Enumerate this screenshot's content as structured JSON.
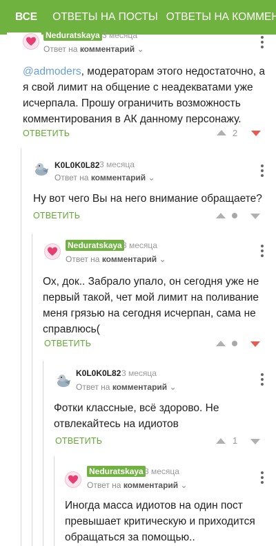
{
  "tabs": [
    "ВСЕ",
    "ОТВЕТЫ НА ПОСТЫ",
    "ОТВЕТЫ НА КОММЕНТАРИИ"
  ],
  "common": {
    "reply_to_prefix": "Ответ на",
    "reply_to_target": "комментарий",
    "reply_button": "ОТВЕТИТЬ"
  },
  "comments": [
    {
      "author": "Neduratskaya",
      "time": "3 месяца",
      "mention": "@admoders",
      "text": ", модераторам этого недостаточно, а я свой лимит на общение с неадекватами уже исчерпала. Прошу ограничить возможность комментирования в АК данному персонажу.",
      "score": "2",
      "my_vote": "down"
    },
    {
      "author": "K0L0K0L82",
      "time": "3 месяца",
      "text": "Ну вот чего Вы на него внимание обращаете?",
      "score": "",
      "my_vote": "none"
    },
    {
      "author": "Neduratskaya",
      "time": "3 месяца",
      "text": "Ох, док.. Забрало упало, он сегодня уже не первый такой, чет мой лимит на поливание меня грязью на сегодня исчерпан, сама не справлюсь(",
      "score": "",
      "my_vote": "down"
    },
    {
      "author": "K0L0K0L82",
      "time": "3 месяца",
      "text": "Фотки классные, всё здорово. Не отвлекайтесь на идиотов",
      "score": "1",
      "my_vote": "none"
    },
    {
      "author": "Neduratskaya",
      "time": "3 месяца",
      "text": "Иногда масса идиотов на один пост превышает критическую и приходится обращаться за помощью..",
      "score": "",
      "my_vote": "none"
    }
  ],
  "colors": {
    "header_green": "#6fb23f",
    "reply_green": "#5faa2f",
    "downvote_red": "#e45b4f",
    "mention_blue": "#6a9fd4"
  }
}
